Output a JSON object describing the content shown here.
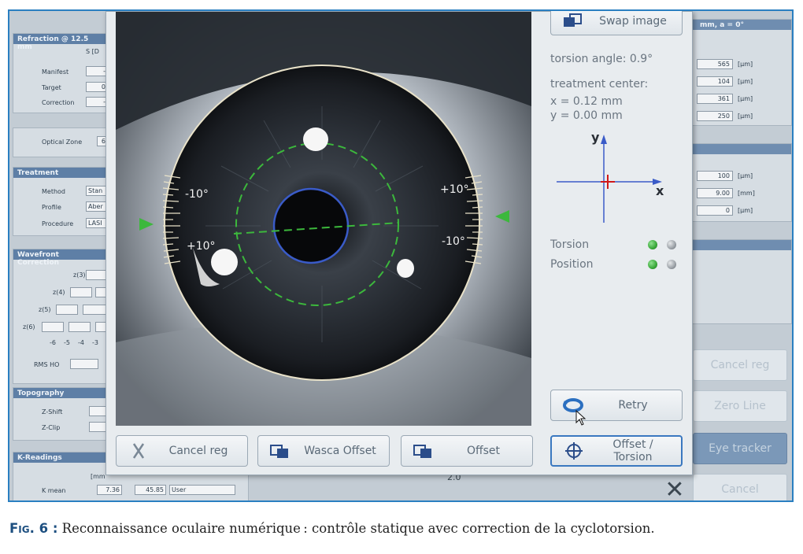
{
  "background": {
    "refraction": {
      "header": "Refraction @ 12.5 mm",
      "col": "S [D",
      "rows": [
        "Manifest",
        "Target",
        "Correction"
      ],
      "row_vals": [
        "-",
        "0",
        "-"
      ],
      "optical_zone": "Optical Zone",
      "optical_zone_val": "6"
    },
    "treatment": {
      "header": "Treatment",
      "rows": [
        "Method",
        "Profile",
        "Procedure"
      ],
      "row_vals": [
        "Stan",
        "Aber",
        "LASI"
      ]
    },
    "wavefront": {
      "header": "Wavefront Correction",
      "rows": [
        "z(3)",
        "z(4)",
        "z(5)",
        "z(6)"
      ],
      "scale": [
        "-6",
        "-5",
        "-4",
        "-3"
      ],
      "rms": "RMS HO"
    },
    "topography": {
      "header": "Topography",
      "rows": [
        "Z-Shift",
        "Z-Clip"
      ]
    },
    "kreadings": {
      "header": "K-Readings",
      "unit": "[mm",
      "row": "K mean",
      "vals": [
        "7.36",
        "45.85",
        "User"
      ]
    },
    "right_top": {
      "header": "mm, a = 0°",
      "vals": [
        "565",
        "104",
        "361",
        "250"
      ],
      "units": [
        "[µm]",
        "[µm]",
        "[µm]",
        "[µm]"
      ]
    },
    "right_mid": {
      "vals": [
        "100",
        "9.00",
        "0"
      ],
      "units": [
        "[µm]",
        "[mm]",
        "[µm]"
      ]
    },
    "right_buttons": {
      "cancel_reg": "Cancel reg",
      "zero_line": "Zero Line",
      "eye_tracker": "Eye tracker",
      "cancel": "Cancel"
    },
    "bottom_value": "2.0"
  },
  "eye": {
    "label_left_top": "-10°",
    "label_left_bottom": "+10°",
    "label_right_top": "+10°",
    "label_right_bottom": "-10°"
  },
  "side_panel": {
    "swap_button": "Swap image",
    "torsion_angle": "torsion angle: 0.9°",
    "treatment_center": "treatment center:",
    "x_value": "x = 0.12 mm",
    "y_value": "y = 0.00 mm",
    "axis_x": "x",
    "axis_y": "y",
    "status_torsion": "Torsion",
    "status_position": "Position",
    "retry_button": "Retry",
    "offset_torsion_button": "Offset / Torsion"
  },
  "bottom_buttons": {
    "cancel_reg": "Cancel reg",
    "wasca_offset": "Wasca Offset",
    "offset": "Offset"
  },
  "colors": {
    "status_green": "#3aa83a",
    "status_gray": "#9aa0a6",
    "marker_green": "#3cb83c",
    "pupil_ring": "#3a5bc8",
    "crosshair_red": "#d01818"
  },
  "caption": {
    "label": "Fig. 6 :",
    "text": " Reconnaissance oculaire numérique : contrôle statique avec correction de la cyclotorsion."
  }
}
